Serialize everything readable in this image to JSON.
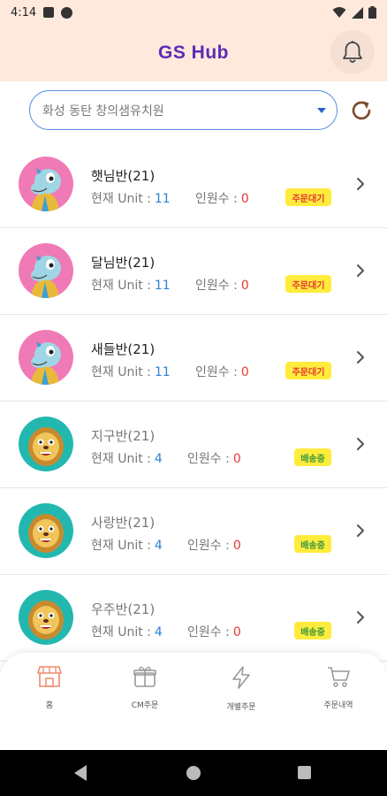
{
  "status_bar": {
    "time": "4:14"
  },
  "header": {
    "title": "GS Hub"
  },
  "selector": {
    "value": "화성 동탄 창의샘유치원"
  },
  "classes": [
    {
      "name": "햇님반(21)",
      "unit_label": "현재 Unit :",
      "unit_value": "11",
      "count_label": "인원수 :",
      "count_value": "0",
      "status": "주문대기",
      "status_type": "waiting",
      "avatar": "dino"
    },
    {
      "name": "달님반(21)",
      "unit_label": "현재 Unit :",
      "unit_value": "11",
      "count_label": "인원수 :",
      "count_value": "0",
      "status": "주문대기",
      "status_type": "waiting",
      "avatar": "dino"
    },
    {
      "name": "새들반(21)",
      "unit_label": "현재 Unit :",
      "unit_value": "11",
      "count_label": "인원수 :",
      "count_value": "0",
      "status": "주문대기",
      "status_type": "waiting",
      "avatar": "dino"
    },
    {
      "name": "지구반(21)",
      "unit_label": "현재 Unit :",
      "unit_value": "4",
      "count_label": "인원수 :",
      "count_value": "0",
      "status": "배송중",
      "status_type": "shipping",
      "avatar": "lion"
    },
    {
      "name": "사랑반(21)",
      "unit_label": "현재 Unit :",
      "unit_value": "4",
      "count_label": "인원수 :",
      "count_value": "0",
      "status": "배송중",
      "status_type": "shipping",
      "avatar": "lion"
    },
    {
      "name": "우주반(21)",
      "unit_label": "현재 Unit :",
      "unit_value": "4",
      "count_label": "인원수 :",
      "count_value": "0",
      "status": "배송중",
      "status_type": "shipping",
      "avatar": "lion"
    }
  ],
  "bottom_nav": [
    {
      "label": "홈",
      "icon": "store-icon",
      "active": true
    },
    {
      "label": "CM주문",
      "icon": "gift-icon",
      "active": false
    },
    {
      "label": "개별주문",
      "icon": "lightning-icon",
      "active": false
    },
    {
      "label": "주문내역",
      "icon": "cart-icon",
      "active": false
    }
  ],
  "colors": {
    "header_bg": "#ffe9dd",
    "title": "#5b2bb5",
    "unit_value": "#2f80d8",
    "count_value": "#e53935",
    "badge_bg": "#ffeb3b",
    "active_nav": "#f08a6a"
  }
}
